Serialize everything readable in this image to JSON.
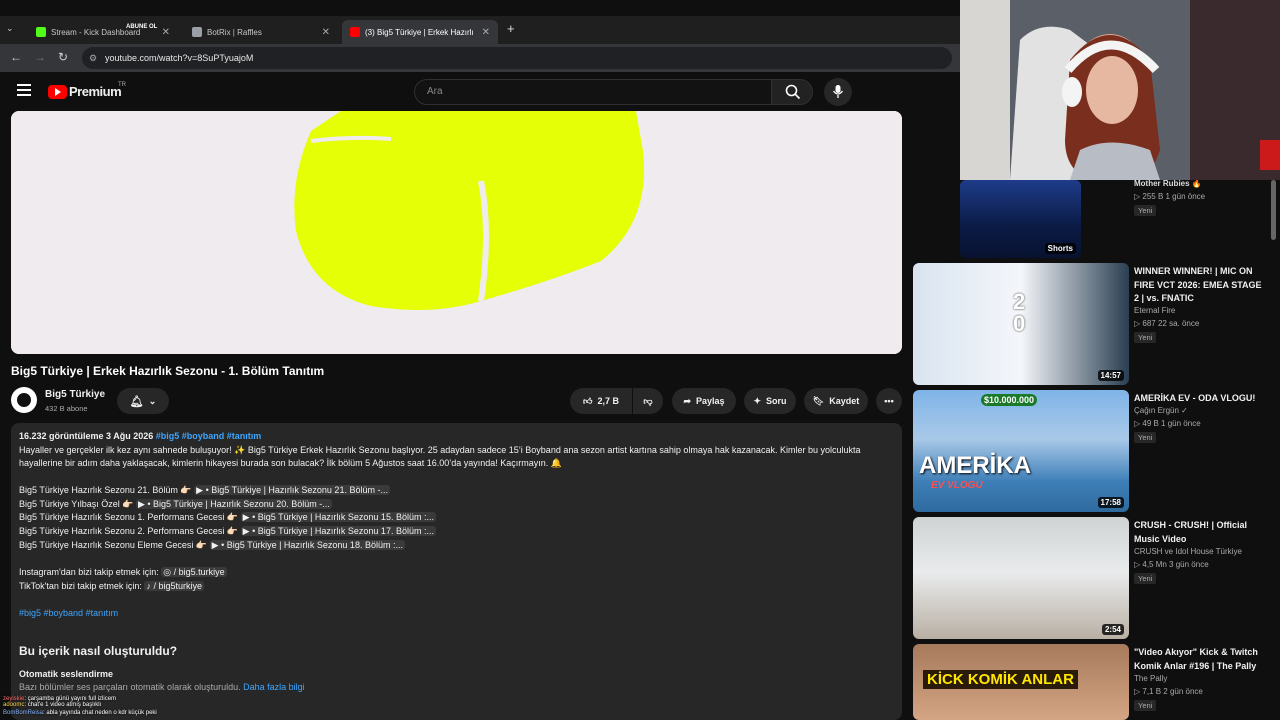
{
  "browser": {
    "tabs": [
      {
        "label": "Stream - Kick Dashboard",
        "active": false
      },
      {
        "label": "BotRix | Raffles",
        "active": false
      },
      {
        "label": "(3) Big5 Türkiye | Erkek Hazırlı",
        "active": true
      }
    ],
    "overlay_text": "ABUNE OL",
    "url": "youtube.com/watch?v=8SuPTyuajoM"
  },
  "youtube": {
    "logo_text": "Premium",
    "logo_region": "TR",
    "search_placeholder": "Ara"
  },
  "video": {
    "title": "Big5 Türkiye | Erkek Hazırlık Sezonu - 1. Bölüm Tanıtım",
    "channel": "Big5 Türkiye",
    "subscribers": "432 B abone",
    "likes": "2,7 B",
    "share_label": "Paylaş",
    "ask_label": "Soru",
    "save_label": "Kaydet"
  },
  "description": {
    "stats": "16.232 görüntüleme  3 Ağu 2026",
    "tags_top": "#big5 #boyband #tanıtım",
    "para1": "Hayaller ve gerçekler ilk kez aynı sahnede buluşuyor! ✨ Big5 Türkiye Erkek Hazırlık Sezonu başlıyor. 25 adaydan sadece 15’i Boyband ana sezon artist kartına sahip olmaya hak kazanacak. Kimler bu yolculukta",
    "para2": "hayallerine bir adım daha yaklaşacak, kimlerin hikayesi burada son bulacak? İlk bölüm 5 Ağustos saat 16.00’da yayında! Kaçırmayın. 🔔",
    "episodes": [
      {
        "label": "Big5 Türkiye Hazırlık Sezonu 21. Bölüm 👉🏻",
        "chip": "▶ • Big5 Türkiye | Hazırlık Sezonu 21. Bölüm -..."
      },
      {
        "label": "Big5 Türkiye Yılbaşı Özel 👉🏻",
        "chip": "▶ • Big5 Türkiye | Hazırlık Sezonu 20. Bölüm -..."
      },
      {
        "label": "Big5 Türkiye Hazırlık Sezonu 1. Performans Gecesi 👉🏻",
        "chip": "▶ • Big5 Türkiye | Hazırlık Sezonu 15. Bölüm :..."
      },
      {
        "label": "Big5 Türkiye Hazırlık Sezonu 2. Performans Gecesi 👉🏻",
        "chip": "▶ • Big5 Türkiye | Hazırlık Sezonu 17. Bölüm :..."
      },
      {
        "label": "Big5 Türkiye Hazırlık Sezonu Eleme Gecesi 👉🏻",
        "chip": "▶ • Big5 Türkiye | Hazırlık Sezonu 18. Bölüm :..."
      }
    ],
    "instagram_label": "Instagram'dan bizi takip etmek için:",
    "instagram_handle": "/ big5.turkiye",
    "tiktok_label": "TikTok'tan bizi takip etmek için:",
    "tiktok_handle": "/ big5turkiye",
    "tags_bottom": "#big5 #boyband #tanıtım",
    "how_made_heading": "Bu içerik nasıl oluşturuldu?",
    "how_made_sub": "Otomatik seslendirme",
    "how_made_text": "Bazı bölümler ses parçaları otomatik olarak oluşturuldu.",
    "more_info": "Daha fazla bilgi"
  },
  "sidebar": [
    {
      "title": "",
      "channel": "Mother Rubies 🔥",
      "meta": "▷ 255 B  1 gün önce",
      "badge": "Yeni",
      "duration": "Shorts"
    },
    {
      "title": "WINNER WINNER! | MIC ON FIRE VCT 2026: EMEA STAGE 2 | vs. FNATIC",
      "channel": "Eternal Fire",
      "meta": "▷ 687  22 sa. önce",
      "badge": "Yeni",
      "duration": "14:57"
    },
    {
      "title": "AMERİKA EV - ODA VLOGU!",
      "channel": "Çağın Ergün ✓",
      "meta": "▷ 49 B  1 gün önce",
      "badge": "Yeni",
      "duration": "17:58",
      "thumb_text": "AMERİKA",
      "thumb_sub": "EV VLOGU",
      "thumb_price": "$10.000.000"
    },
    {
      "title": "CRUSH - CRUSH! | Official Music Video",
      "channel": "CRUSH ve Idol House Türkiye",
      "meta": "▷ 4,5 Mn  3 gün önce",
      "badge": "Yeni",
      "duration": "2:54"
    },
    {
      "title": "\"Video Akıyor\" Kick & Twitch Komik Anlar #196 | The Pally",
      "channel": "The Pally",
      "meta": "▷ 7,1 B  2 gün önce",
      "badge": "Yeni",
      "thumb_text": "KİCK KOMİK ANLAR"
    }
  ],
  "chat": [
    {
      "user": "BomBomReisa",
      "text": ": abla yayında chat neden o kdr küçük peki"
    },
    {
      "user": "zeyiskie",
      "text": ": çarşamba günü yayını full izlicem"
    },
    {
      "user": "adoomc",
      "text": ": chat'e 1 video atmış başlıklı"
    }
  ],
  "colors": {
    "accent": "#3ea6ff",
    "yt_red": "#ff0000",
    "bg": "#0f0f0f"
  }
}
